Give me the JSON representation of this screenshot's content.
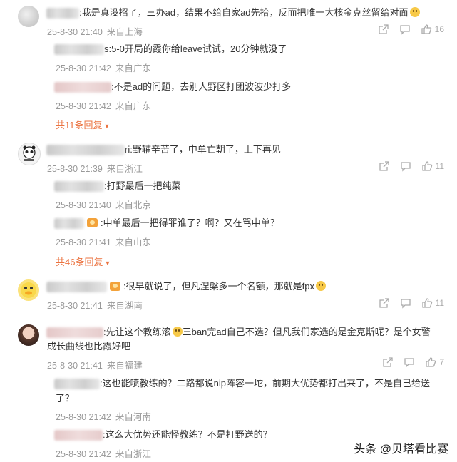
{
  "comments": [
    {
      "text": ":我是真没招了，三办ad，结果不给自家ad先拾，反而把唯一大核金克丝留给对面",
      "time": "25-8-30 21:40",
      "location": "来自上海",
      "likes": "16",
      "replies": [
        {
          "text": "s:5-0开局的霞你给leave试试，20分钟就没了",
          "time": "25-8-30 21:42",
          "location": "来自广东"
        },
        {
          "text": ":不是ad的问题，去别人野区打团波波少打多",
          "time": "25-8-30 21:42",
          "location": "来自广东"
        }
      ],
      "more": "共11条回复"
    },
    {
      "text": "ri:野辅辛苦了，中单亡朝了，上下再见",
      "time": "25-8-30 21:39",
      "location": "来自浙江",
      "likes": "11",
      "replies": [
        {
          "text": ":打野最后一把纯菜",
          "time": "25-8-30 21:40",
          "location": "来自北京"
        },
        {
          "text": ":中单最后一把得罪谁了？啊？又在骂中单？",
          "time": "25-8-30 21:41",
          "location": "来自山东"
        }
      ],
      "more": "共46条回复"
    },
    {
      "text": ":很早就说了，但凡涅槃多一个名额，那就是fpx",
      "time": "25-8-30 21:41",
      "location": "来自湖南",
      "likes": "11"
    },
    {
      "text_line1": ":先让这个教练滚",
      "text_line1b": "三ban完ad自己不选？但凡我们家选的是金克斯呢？是个女警",
      "text_line2": "成长曲线也比霞好吧",
      "time": "25-8-30 21:41",
      "location": "来自福建",
      "likes": "7",
      "replies": [
        {
          "text_line1": ":这也能喷教练的？二路都说nip阵容一坨，前期大优势都打出来了，不是自己给送",
          "text_line2": "了？",
          "time": "25-8-30 21:42",
          "location": "来自河南"
        },
        {
          "text": ":这么大优势还能怪教练？不是打野送的？",
          "time": "25-8-30 21:42",
          "location": "来自浙江"
        }
      ]
    }
  ],
  "watermark": "头条 @贝塔看比赛",
  "colors": {
    "accent": "#eb7340",
    "meta": "#999999",
    "text": "#333333"
  }
}
